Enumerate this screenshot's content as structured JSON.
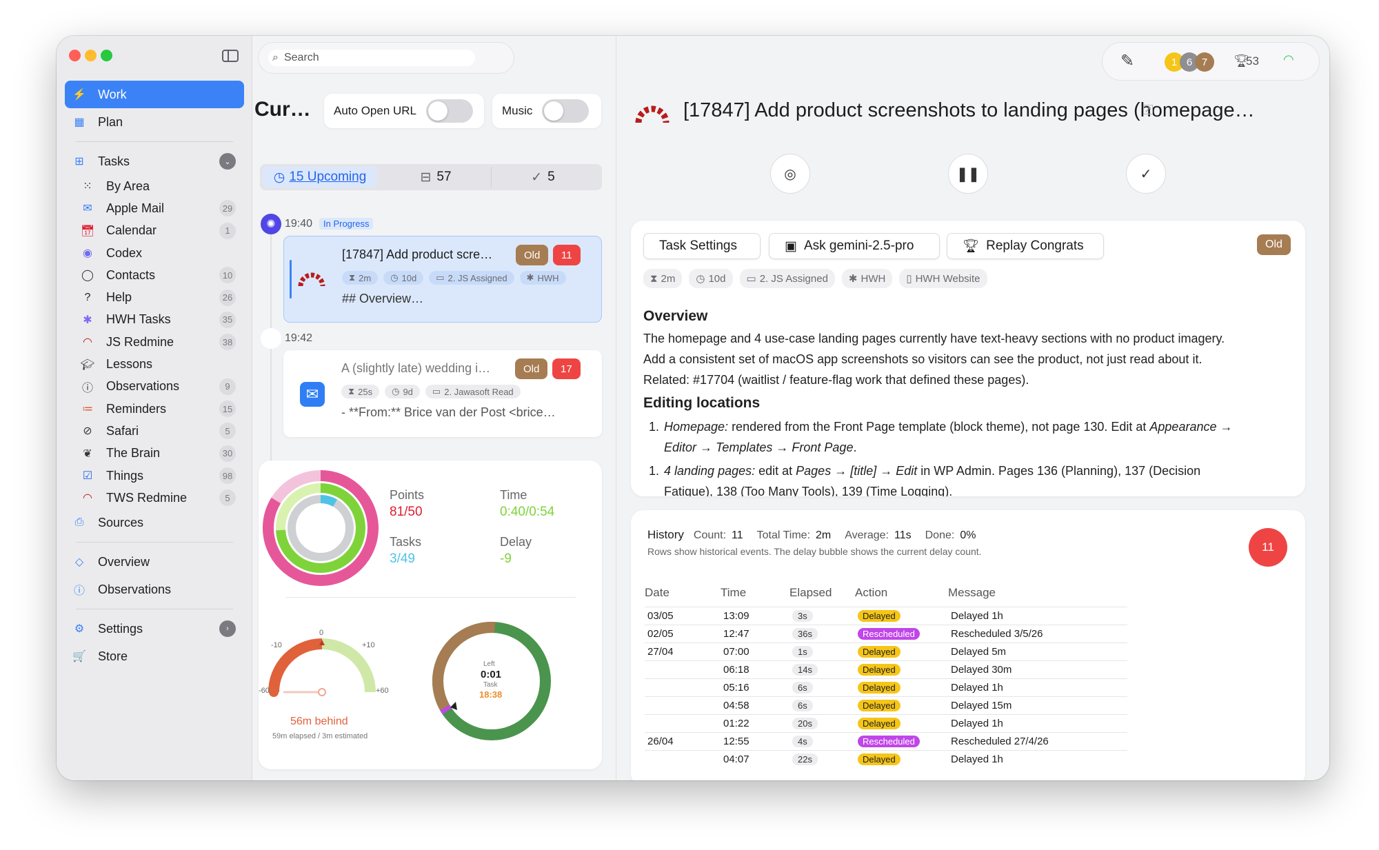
{
  "sidebar": {
    "items": [
      {
        "label": "Work",
        "icon": "bolt-icon",
        "active": true
      },
      {
        "label": "Plan",
        "icon": "calendar-grid-icon"
      }
    ],
    "tasks": {
      "label": "Tasks",
      "icon": "grid-icon"
    },
    "sources_list": [
      {
        "label": "By Area",
        "icon": "dots-grid-icon",
        "count": ""
      },
      {
        "label": "Apple Mail",
        "icon": "mail-icon",
        "count": "29"
      },
      {
        "label": "Calendar",
        "icon": "calendar-icon",
        "count": "1"
      },
      {
        "label": "Codex",
        "icon": "codex-icon",
        "count": ""
      },
      {
        "label": "Contacts",
        "icon": "contacts-icon",
        "count": "10"
      },
      {
        "label": "Help",
        "icon": "help-icon",
        "count": "26"
      },
      {
        "label": "HWH Tasks",
        "icon": "hwh-icon",
        "count": "35"
      },
      {
        "label": "JS Redmine",
        "icon": "redmine-icon",
        "count": "38"
      },
      {
        "label": "Lessons",
        "icon": "graduation-cap-icon",
        "count": ""
      },
      {
        "label": "Observations",
        "icon": "info-icon",
        "count": "9"
      },
      {
        "label": "Reminders",
        "icon": "list-icon",
        "count": "15"
      },
      {
        "label": "Safari",
        "icon": "compass-icon",
        "count": "5"
      },
      {
        "label": "The Brain",
        "icon": "brain-icon",
        "count": "30"
      },
      {
        "label": "Things",
        "icon": "checkbox-icon",
        "count": "98"
      },
      {
        "label": "TWS Redmine",
        "icon": "redmine-icon",
        "count": "5"
      }
    ],
    "sources": {
      "label": "Sources"
    },
    "overview": {
      "label": "Overview"
    },
    "observations": {
      "label": "Observations"
    },
    "settings": {
      "label": "Settings"
    },
    "store": {
      "label": "Store"
    }
  },
  "middle": {
    "search_placeholder": "Search",
    "title": "Cur…",
    "auto_open_url": "Auto Open URL",
    "music": "Music",
    "tabs": [
      {
        "label": "15 Upcoming"
      },
      {
        "label": "57"
      },
      {
        "label": "5"
      }
    ],
    "tasks": [
      {
        "time": "19:40",
        "status": "In Progress",
        "title": "[17847] Add product scre…",
        "old": "Old",
        "num": "11",
        "pills": [
          "2m",
          "10d",
          "2. JS Assigned",
          "HWH"
        ],
        "snippet": "## Overview…"
      },
      {
        "time": "19:42",
        "status": "",
        "title": "A (slightly late) wedding i…",
        "old": "Old",
        "num": "17",
        "pills": [
          "25s",
          "9d",
          "2. Jawasoft Read"
        ],
        "snippet": "- **From:** Brice van der Post <brice…"
      }
    ],
    "stats": {
      "points_label": "Points",
      "points_value": "81/50",
      "time_label": "Time",
      "time_value": "0:40/0:54",
      "tasks_label": "Tasks",
      "tasks_value": "3/49",
      "delay_label": "Delay",
      "delay_value": "-9"
    },
    "gauge": {
      "ticks": [
        "-10",
        "0",
        "+10",
        "-60",
        "+60"
      ],
      "behind": "56m behind",
      "sub": "59m elapsed / 3m estimated"
    },
    "timer": {
      "left_label": "Left",
      "left_value": "0:01",
      "task_label": "Task",
      "task_value": "18:38"
    }
  },
  "toolbar": {
    "badges": [
      "1",
      "6",
      "7"
    ],
    "trophy": "53"
  },
  "detail": {
    "title": "[17847] Add product screenshots to landing pages (homepage…",
    "buttons": {
      "settings": "Task Settings",
      "ask": "Ask gemini-2.5-pro",
      "replay": "Replay Congrats",
      "old": "Old"
    },
    "pills": [
      "2m",
      "10d",
      "2. JS Assigned",
      "HWH",
      "HWH Website"
    ],
    "overview_heading": "Overview",
    "overview_p1": "The homepage and 4 use-case landing pages currently have text-heavy sections with no product imagery.",
    "overview_p2": "Add a consistent set of macOS app screenshots so visitors can see the product, not just read about it.",
    "overview_p3": "Related: #17704 (waitlist / feature-flag work that defined these pages).",
    "editing_heading": "Editing locations",
    "li1_em": "Homepage:",
    "li1_text": " rendered from the Front Page template (block theme), not page 130. Edit at ",
    "li1_em2": "Appearance →",
    "li1_line2": "Editor → Templates → Front Page",
    "li2_em": "4 landing pages:",
    "li2_text": " edit at ",
    "li2_em2": "Pages → [title] → Edit",
    "li2_text2": " in WP Admin. Pages 136 (Planning), 137 (Decision",
    "li2_line2": "Fatigue), 138 (Too Many Tools), 139 (Time Logging)."
  },
  "history": {
    "label": "History",
    "count_label": "Count:",
    "count": "11",
    "total_label": "Total Time:",
    "total": "2m",
    "avg_label": "Average:",
    "avg": "11s",
    "done_label": "Done:",
    "done": "0%",
    "subtitle": "Rows show historical events. The delay bubble shows the current delay count.",
    "bubble": "11",
    "columns": [
      "Date",
      "Time",
      "Elapsed",
      "Action",
      "Message"
    ],
    "rows": [
      {
        "date": "03/05",
        "time": "13:09",
        "elapsed": "3s",
        "action": "Delayed",
        "message": "Delayed 1h"
      },
      {
        "date": "02/05",
        "time": "12:47",
        "elapsed": "36s",
        "action": "Rescheduled",
        "message": "Rescheduled 3/5/26"
      },
      {
        "date": "27/04",
        "time": "07:00",
        "elapsed": "1s",
        "action": "Delayed",
        "message": "Delayed 5m"
      },
      {
        "date": "",
        "time": "06:18",
        "elapsed": "14s",
        "action": "Delayed",
        "message": "Delayed 30m"
      },
      {
        "date": "",
        "time": "05:16",
        "elapsed": "6s",
        "action": "Delayed",
        "message": "Delayed 1h"
      },
      {
        "date": "",
        "time": "04:58",
        "elapsed": "6s",
        "action": "Delayed",
        "message": "Delayed 15m"
      },
      {
        "date": "",
        "time": "01:22",
        "elapsed": "20s",
        "action": "Delayed",
        "message": "Delayed 1h"
      },
      {
        "date": "26/04",
        "time": "12:55",
        "elapsed": "4s",
        "action": "Rescheduled",
        "message": "Rescheduled 27/4/26"
      },
      {
        "date": "",
        "time": "04:07",
        "elapsed": "22s",
        "action": "Delayed",
        "message": "Delayed 1h"
      }
    ]
  }
}
